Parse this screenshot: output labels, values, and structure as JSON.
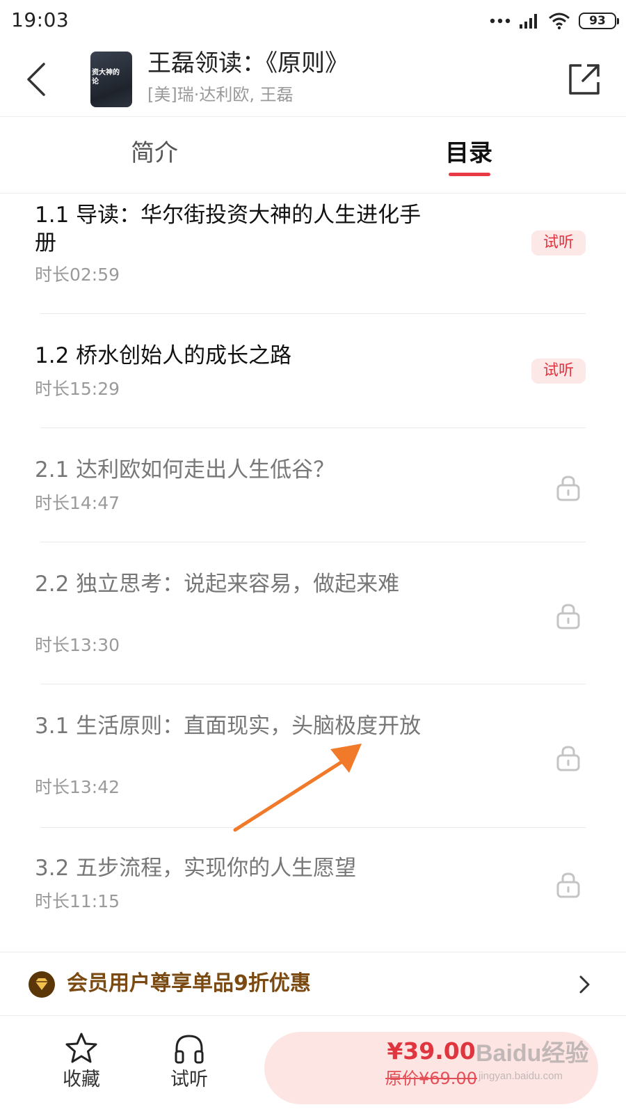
{
  "status_bar": {
    "time": "19:03",
    "battery": "93"
  },
  "header": {
    "cover_text": "资大神的\n论",
    "title": "王磊领读：《原则》",
    "authors": "[美]瑞·达利欧, 王磊"
  },
  "tabs": {
    "intro": "简介",
    "catalog": "目录",
    "active": "catalog"
  },
  "episodes": [
    {
      "title": "1.1 导读：华尔街投资大神的人生进化手册",
      "duration": "时长02:59",
      "trial": "试听",
      "locked": false
    },
    {
      "title": "1.2 桥水创始人的成长之路",
      "duration": "时长15:29",
      "trial": "试听",
      "locked": false
    },
    {
      "title": "2.1 达利欧如何走出人生低谷？",
      "duration": "时长14:47",
      "locked": true
    },
    {
      "title": "2.2 独立思考：说起来容易，做起来难",
      "duration": "时长13:30",
      "locked": true
    },
    {
      "title": "3.1 生活原则：直面现实，头脑极度开放",
      "duration": "时长13:42",
      "locked": true
    },
    {
      "title": "3.2 五步流程，实现你的人生愿望",
      "duration": "时长11:15",
      "locked": true
    }
  ],
  "member_banner": {
    "text": "会员用户尊享单品9折优惠"
  },
  "bottom_bar": {
    "favorite_label": "收藏",
    "trial_label": "试听",
    "price": "¥39.00",
    "original_price": "原价¥69.00"
  },
  "watermark": {
    "brand": "Baidu经验",
    "url": "jingyan.baidu.com"
  },
  "colors": {
    "accent": "#e83a44",
    "trial_badge_bg": "#fde8e8",
    "member_gold": "#7a4a12",
    "buy_bg": "#fde5e3",
    "annotation_arrow": "#f07a2a"
  },
  "icons": {
    "back": "chevron-left-icon",
    "share": "share-external-icon",
    "lock": "lock-icon",
    "member": "member-diamond-icon",
    "favorite": "star-outline-icon",
    "listen": "headphones-icon"
  }
}
